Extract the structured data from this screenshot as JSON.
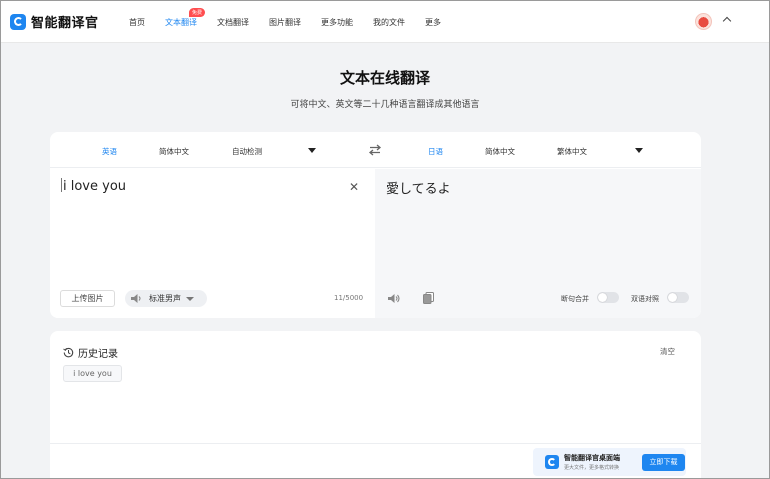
{
  "header": {
    "app_name": "智能翻译官",
    "nav": [
      {
        "label": "首页",
        "active": false
      },
      {
        "label": "文本翻译",
        "active": true,
        "badge": "免费"
      },
      {
        "label": "文档翻译",
        "active": false
      },
      {
        "label": "图片翻译",
        "active": false
      },
      {
        "label": "更多功能",
        "active": false
      },
      {
        "label": "我的文件",
        "active": false
      },
      {
        "label": "更多",
        "active": false
      }
    ]
  },
  "page": {
    "title": "文本在线翻译",
    "subtitle": "可将中文、英文等二十几种语言翻译成其他语言"
  },
  "translator": {
    "source_langs": [
      {
        "label": "英语",
        "selected": true
      },
      {
        "label": "简体中文",
        "selected": false
      },
      {
        "label": "自动检测",
        "selected": false
      }
    ],
    "target_langs": [
      {
        "label": "日语",
        "selected": true
      },
      {
        "label": "简体中文",
        "selected": false
      },
      {
        "label": "繁体中文",
        "selected": false
      }
    ],
    "source_text": "i love you",
    "target_text": "愛してるよ",
    "upload_label": "上传图片",
    "voice_label": "标准男声",
    "char_count": "11/5000",
    "toggle_sentence_label": "断句合并",
    "toggle_bilingual_label": "双语对照",
    "toggle_sentence_on": false,
    "toggle_bilingual_on": false
  },
  "history": {
    "title": "历史记录",
    "clear_label": "清空",
    "items": [
      "i love you"
    ]
  },
  "promo": {
    "title": "智能翻译官桌面端",
    "subtitle": "更大文件，更多格式转换",
    "button_label": "立即下载"
  },
  "colors": {
    "accent": "#1e86f0",
    "badge": "#ff4d4f",
    "background": "#f2f3f5"
  }
}
